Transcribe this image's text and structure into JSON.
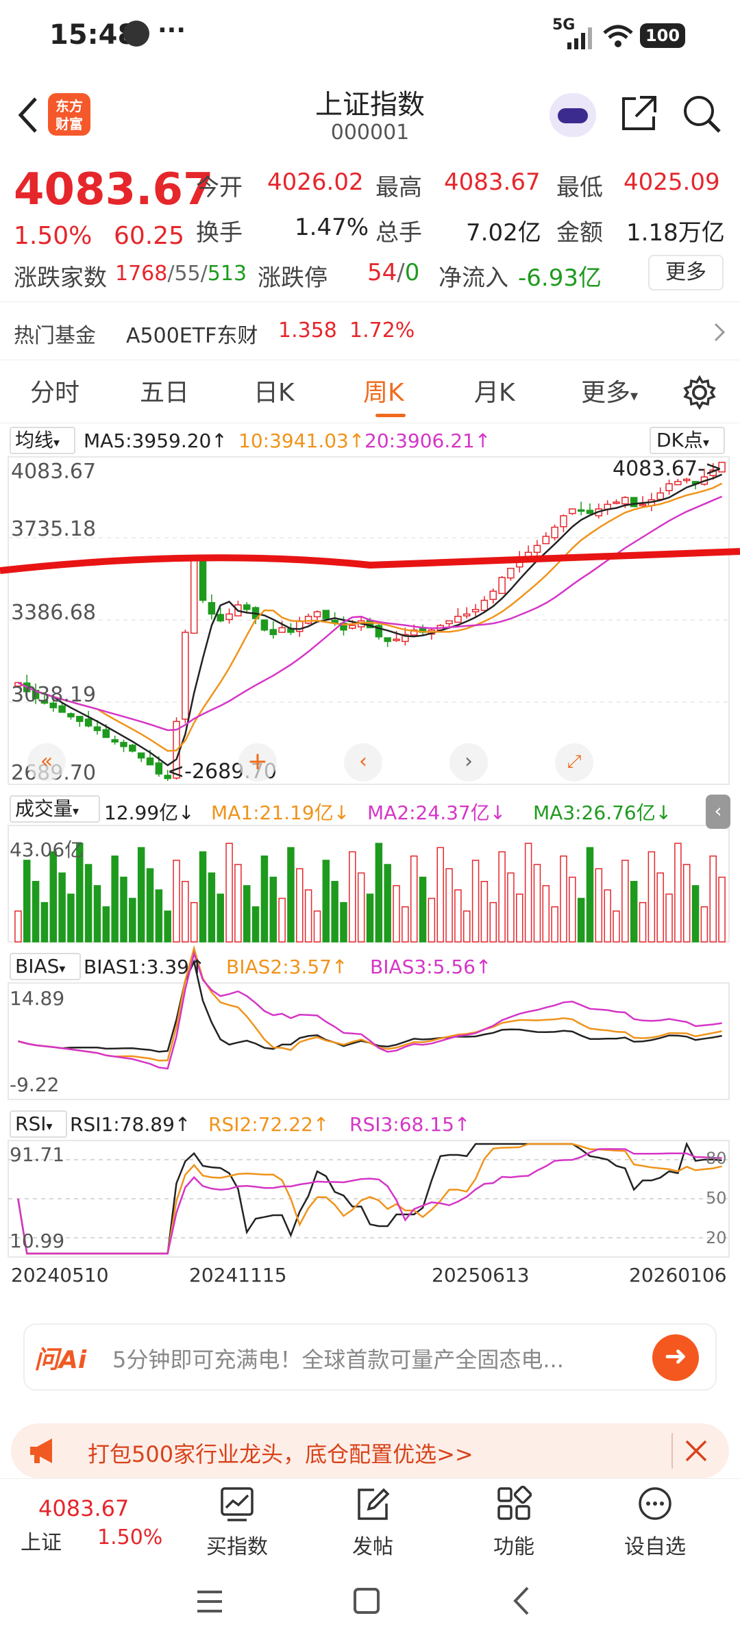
{
  "status_bar": {
    "time": "15:48",
    "more": "···",
    "network": "5G",
    "battery": "100"
  },
  "header": {
    "title": "上证指数",
    "code": "000001",
    "logo_text": "东方财富"
  },
  "quote": {
    "price": "4083.67",
    "change_pct": "1.50%",
    "change_abs": "60.25",
    "open_label": "今开",
    "open_value": "4026.02",
    "high_label": "最高",
    "high_value": "4083.67",
    "low_label": "最低",
    "low_value": "4025.09",
    "turnover_label": "换手",
    "turnover_value": "1.47%",
    "volume_label": "总手",
    "volume_value": "7.02亿",
    "amount_label": "金额",
    "amount_value": "1.18万亿",
    "breadth_label": "涨跌家数",
    "breadth_up": "1768",
    "breadth_flat": "55",
    "breadth_down": "513",
    "limit_label": "涨跌停",
    "limit_up": "54",
    "limit_down": "0",
    "netflow_label": "净流入",
    "netflow_value": "-6.93亿",
    "more_button": "更多"
  },
  "hot_fund": {
    "label": "热门基金",
    "name": "A500ETF东财",
    "price": "1.358",
    "change": "1.72%"
  },
  "tabs": [
    "分时",
    "五日",
    "日K",
    "周K",
    "月K",
    "更多"
  ],
  "active_tab": 3,
  "ma_legend": {
    "selector": "均线",
    "ma5": "MA5:3959.20↑",
    "ma10": "10:3941.03↑",
    "ma20": "20:3906.21↑",
    "dk": "DK点"
  },
  "price_axis": [
    "4083.67",
    "3735.18",
    "3386.68",
    "3038.19",
    "2689.70"
  ],
  "price_annot_high": "4083.67->",
  "price_annot_low": "<-2689.70",
  "vol_legend": {
    "selector": "成交量",
    "vol": "12.99亿↓",
    "ma1": "MA1:21.19亿↓",
    "ma2": "MA2:24.37亿↓",
    "ma3": "MA3:26.76亿↓",
    "axis_max": "43.06亿"
  },
  "bias_legend": {
    "selector": "BIAS",
    "b1": "BIAS1:3.39↑",
    "b2": "BIAS2:3.57↑",
    "b3": "BIAS3:5.56↑",
    "axis_max": "14.89",
    "axis_min": "-9.22"
  },
  "rsi_legend": {
    "selector": "RSI",
    "r1": "RSI1:78.89↑",
    "r2": "RSI2:72.22↑",
    "r3": "RSI3:68.15↑",
    "axis_max": "91.71",
    "axis_min": "10.99",
    "ref80": "80",
    "ref50": "50",
    "ref20": "20"
  },
  "date_axis": [
    "20240510",
    "20241115",
    "20250613",
    "20260106"
  ],
  "ai_bar": {
    "logo": "问Ai",
    "text": "5分钟即可充满电！全球首款可量产全固态电..."
  },
  "promo": {
    "text": "打包500家行业龙头，底仓配置优选>>"
  },
  "bottom_nav": {
    "index_name": "上证",
    "index_price": "4083.67",
    "index_pct": "1.50%",
    "items": [
      "买指数",
      "发帖",
      "功能",
      "设自选"
    ]
  },
  "colors": {
    "up": "#e5262b",
    "down": "#1e9a1e",
    "ma10": "#f0931a",
    "ma20": "#d535c7",
    "accent": "#f06b1e"
  },
  "chart_data": {
    "type": "candlestick",
    "title": "上证指数 周K",
    "ylim": [
      2689.7,
      4083.67
    ],
    "x_ticks": [
      "20240510",
      "20241115",
      "20250613",
      "20260106"
    ],
    "close_series": [
      3120,
      3080,
      3050,
      3030,
      3010,
      2990,
      2970,
      2950,
      2930,
      2910,
      2880,
      2860,
      2840,
      2820,
      2790,
      2760,
      2720,
      2700,
      2950,
      3340,
      3660,
      3480,
      3420,
      3390,
      3420,
      3460,
      3440,
      3400,
      3350,
      3330,
      3360,
      3340,
      3390,
      3410,
      3430,
      3400,
      3380,
      3350,
      3370,
      3390,
      3360,
      3320,
      3300,
      3310,
      3330,
      3350,
      3340,
      3350,
      3370,
      3390,
      3410,
      3420,
      3440,
      3480,
      3520,
      3580,
      3620,
      3660,
      3690,
      3720,
      3760,
      3800,
      3850,
      3880,
      3870,
      3860,
      3880,
      3900,
      3910,
      3930,
      3890,
      3900,
      3920,
      3950,
      3990,
      4000,
      4010,
      3990,
      4020,
      4050,
      4083.67
    ],
    "ma5_last": 3959.2,
    "ma10_last": 3941.03,
    "ma20_last": 3906.21,
    "volume_unit": "亿",
    "volume_max": 43.06,
    "volume_last": 12.99,
    "volume_ma": [
      21.19,
      24.37,
      26.76
    ],
    "bias_last": [
      3.39,
      3.57,
      5.56
    ],
    "rsi_last": [
      78.89,
      72.22,
      68.15
    ]
  }
}
